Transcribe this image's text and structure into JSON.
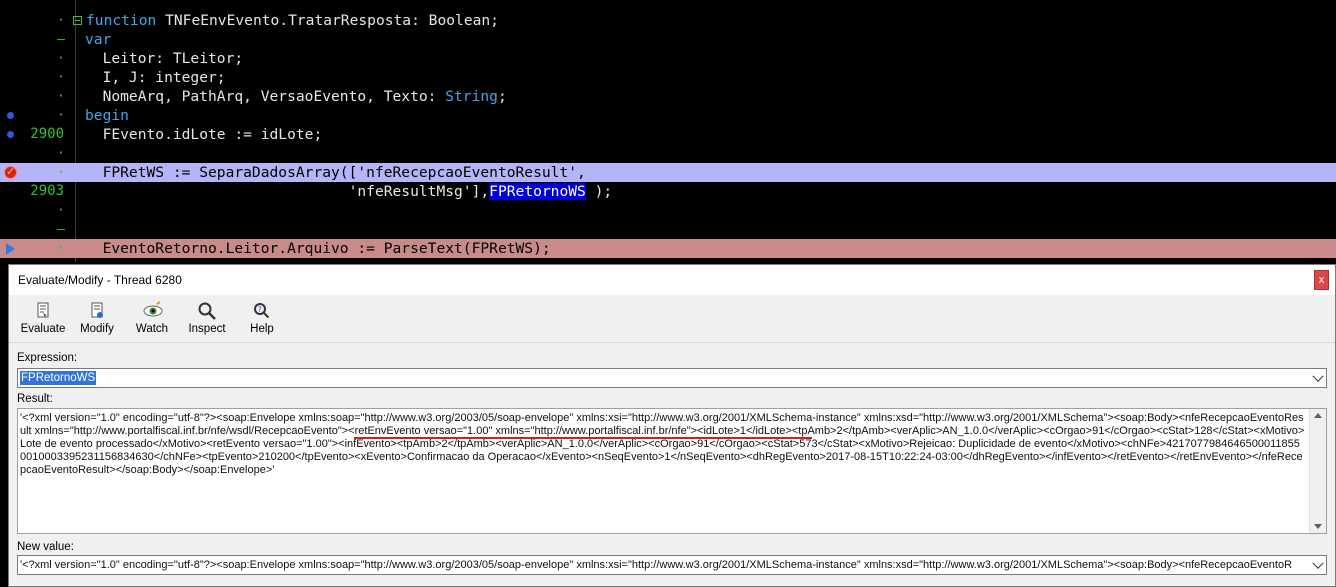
{
  "editor": {
    "lines": [
      {
        "ln": "",
        "fold": "·",
        "segments": [
          {
            "kw": true,
            "t": "function"
          },
          {
            "t": " TNFeEnvEvento.TratarResposta: Boolean;"
          }
        ]
      },
      {
        "ln": "",
        "fold": "–",
        "segments": [
          {
            "kw": true,
            "t": "var"
          }
        ]
      },
      {
        "ln": "",
        "fold": "·",
        "segments": [
          {
            "t": "  Leitor: TLeitor;"
          }
        ]
      },
      {
        "ln": "",
        "fold": "·",
        "segments": [
          {
            "t": "  I, J: integer;"
          }
        ]
      },
      {
        "ln": "",
        "fold": "·",
        "segments": [
          {
            "t": "  NomeArq, PathArq, VersaoEvento, Texto: "
          },
          {
            "kw": true,
            "t": "String"
          },
          {
            "t": ";"
          }
        ]
      },
      {
        "ln": "",
        "fold": "·",
        "segments": [
          {
            "kw": true,
            "t": "begin"
          }
        ]
      },
      {
        "ln": "2900",
        "fold": "",
        "segments": [
          {
            "t": "  FEvento.idLote := idLote;"
          }
        ]
      },
      {
        "ln": "",
        "fold": "·",
        "segments": [
          {
            "t": ""
          }
        ]
      },
      {
        "ln": "",
        "fold": "·",
        "segments": [
          {
            "t": "  FPRetWS := SeparaDadosArray(['nfeRecepcaoEventoResult',"
          }
        ]
      },
      {
        "ln": "2903",
        "fold": "",
        "segments": [
          {
            "t": "                              'nfeResultMsg'],"
          },
          {
            "sel": true,
            "t": "FPRetornoWS"
          },
          {
            "t": " );"
          }
        ]
      },
      {
        "ln": "",
        "fold": "·",
        "segments": [
          {
            "t": ""
          }
        ]
      },
      {
        "ln": "",
        "fold": "–",
        "segments": [
          {
            "t": ""
          }
        ]
      },
      {
        "ln": "",
        "fold": "·",
        "segments": [
          {
            "t": "  EventoRetorno.Leitor.Arquivo := ParseText(FPRetWS);"
          }
        ]
      }
    ]
  },
  "dialog": {
    "title": "Evaluate/Modify - Thread 6280",
    "close_label": "x",
    "toolbar": [
      {
        "label": "Evaluate",
        "icon": "evaluate-icon"
      },
      {
        "label": "Modify",
        "icon": "modify-icon"
      },
      {
        "label": "Watch",
        "icon": "watch-icon"
      },
      {
        "label": "Inspect",
        "icon": "inspect-icon"
      },
      {
        "label": "Help",
        "icon": "help-icon"
      }
    ],
    "expression_label": "Expression:",
    "expression_value": "FPRetornoWS",
    "result_label": "Result:",
    "result_value": "'<?xml version=\"1.0\" encoding=\"utf-8\"?><soap:Envelope xmlns:soap=\"http://www.w3.org/2003/05/soap-envelope\" xmlns:xsi=\"http://www.w3.org/2001/XMLSchema-instance\" xmlns:xsd=\"http://www.w3.org/2001/XMLSchema\"><soap:Body><nfeRecepcaoEventoResult xmlns=\"http://www.portalfiscal.inf.br/nfe/wsdl/RecepcaoEvento\"><retEnvEvento versao=\"1.00\" xmlns=\"http://www.portalfiscal.inf.br/nfe\"><idLote>1</idLote><tpAmb>2</tpAmb><verAplic>AN_1.0.0</verAplic><cOrgao>91</cOrgao><cStat>128</cStat><xMotivo>Lote de evento processado</xMotivo><retEvento versao=\"1.00\"><infEvento><tpAmb>2</tpAmb><verAplic>AN_1.0.0</verAplic><cOrgao>91</cOrgao><cStat>573</cStat><xMotivo>Rejeicao: Duplicidade de evento</xMotivo><chNFe>42170779846465000118550010003395231156834630</chNFe><tpEvento>210200</tpEvento><xEvento>Confirmacao da Operacao</xEvento><nSeqEvento>1</nSeqEvento><dhRegEvento>2017-08-15T10:22:24-03:00</dhRegEvento></infEvento></retEvento></retEnvEvento></nfeRecepcaoEventoResult></soap:Body></soap:Envelope>'",
    "new_value_label": "New value:",
    "new_value": "'<?xml version=\"1.0\" encoding=\"utf-8\"?><soap:Envelope xmlns:soap=\"http://www.w3.org/2003/05/soap-envelope\" xmlns:xsi=\"http://www.w3.org/2001/XMLSchema-instance\" xmlns:xsd=\"http://www.w3.org/2001/XMLSchema\"><soap:Body><nfeRecepcaoEventoR"
  }
}
